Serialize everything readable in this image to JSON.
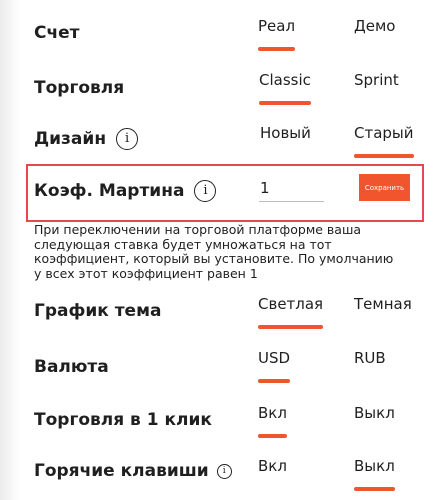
{
  "settings": {
    "account": {
      "label": "Счет",
      "options": [
        "Реал",
        "Демо"
      ],
      "selected_index": 0
    },
    "trading": {
      "label": "Торговля",
      "options": [
        "Classic",
        "Sprint"
      ],
      "selected_index": 0
    },
    "design": {
      "label": "Дизайн",
      "options": [
        "Новый",
        "Старый"
      ],
      "selected_index": 1
    },
    "martin": {
      "label": "Коэф. Мартина",
      "value": "1",
      "save_label": "Сохранить",
      "hint": "При переключении на торговой платформе ваша следующая ставка будет умножаться на тот коэффициент, который вы установите. По умолчанию у всех этот коэффициент равен 1"
    },
    "chart_theme": {
      "label": "График тема",
      "options": [
        "Светлая",
        "Темная"
      ],
      "selected_index": 0
    },
    "currency": {
      "label": "Валюта",
      "options": [
        "USD",
        "RUB"
      ],
      "selected_index": 0
    },
    "one_click": {
      "label": "Торговля в 1 клик",
      "options": [
        "Вкл",
        "Выкл"
      ],
      "selected_index": 0
    },
    "hotkeys": {
      "label": "Горячие клавиши",
      "options": [
        "Вкл",
        "Выкл"
      ],
      "selected_index": 1
    }
  },
  "icons": {
    "info": "info-icon"
  },
  "colors": {
    "accent": "#f0552d",
    "highlight_border": "#e5484d"
  }
}
